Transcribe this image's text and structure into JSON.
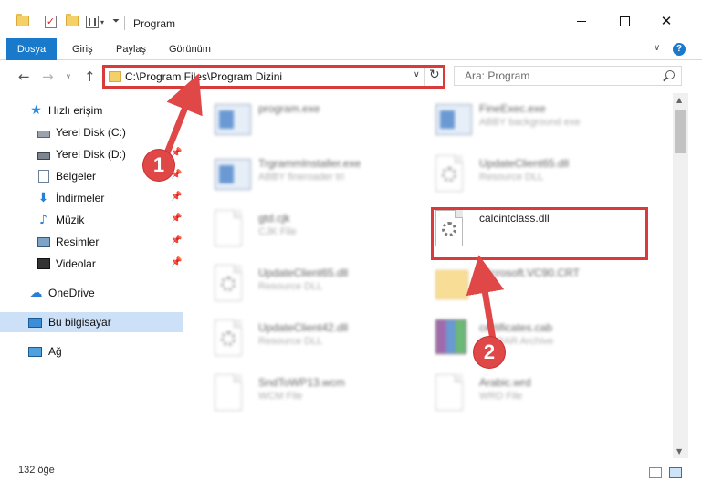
{
  "window": {
    "title": "Program"
  },
  "ribbon": {
    "tabs": [
      "Dosya",
      "Giriş",
      "Paylaş",
      "Görünüm"
    ],
    "active_tab": "Dosya"
  },
  "navigation": {
    "address": "C:\\Program Files\\Program Dizini",
    "search_placeholder": "Ara: Program"
  },
  "sidebar": {
    "items": [
      {
        "label": "Hızlı erişim",
        "icon": "star-icon"
      },
      {
        "label": "Yerel Disk (C:)",
        "icon": "drive-icon"
      },
      {
        "label": "Yerel Disk (D:)",
        "icon": "drive-icon"
      },
      {
        "label": "Belgeler",
        "icon": "documents-icon"
      },
      {
        "label": "İndirmeler",
        "icon": "download-icon"
      },
      {
        "label": "Müzik",
        "icon": "music-icon"
      },
      {
        "label": "Resimler",
        "icon": "pictures-icon"
      },
      {
        "label": "Videolar",
        "icon": "video-icon"
      },
      {
        "label": "OneDrive",
        "icon": "cloud-icon"
      },
      {
        "label": "Bu bilgisayar",
        "icon": "computer-icon"
      },
      {
        "label": "Ağ",
        "icon": "network-icon"
      }
    ],
    "selected": "Bu bilgisayar"
  },
  "files": [
    {
      "name": "program.exe",
      "type": "",
      "icon": "exe-icon"
    },
    {
      "name": "FineExec.exe",
      "type": "ABBY background exe",
      "icon": "exe-icon"
    },
    {
      "name": "TrgrammInstaller.exe",
      "type": "ABBY fineroader tri",
      "icon": "exe-icon"
    },
    {
      "name": "UpdateClient65.dll",
      "type": "Resource DLL",
      "icon": "dll-icon"
    },
    {
      "name": "gtd.cjk",
      "type": "CJK File",
      "icon": "file-icon"
    },
    {
      "name": "calcintclass.dll",
      "type": "",
      "icon": "dll-icon"
    },
    {
      "name": "UpdateClient65.dll",
      "type": "Resource DLL",
      "icon": "dll-icon"
    },
    {
      "name": "Microsoft.VC90.CRT",
      "type": "",
      "icon": "folder-icon"
    },
    {
      "name": "UpdateClient42.dll",
      "type": "Resource DLL",
      "icon": "dll-icon"
    },
    {
      "name": "certificates.cab",
      "type": "WinRAR Archive",
      "icon": "archive-icon"
    },
    {
      "name": "SndToWP13.wcm",
      "type": "WCM File",
      "icon": "file-icon"
    },
    {
      "name": "Arabic.wrd",
      "type": "WRD File",
      "icon": "file-icon"
    }
  ],
  "status": {
    "count": "132 öğe"
  },
  "annotations": {
    "step1": "1",
    "step2": "2"
  },
  "colors": {
    "accent": "#1979ca",
    "highlight": "#d93a3a",
    "selected": "#cce0f7"
  }
}
